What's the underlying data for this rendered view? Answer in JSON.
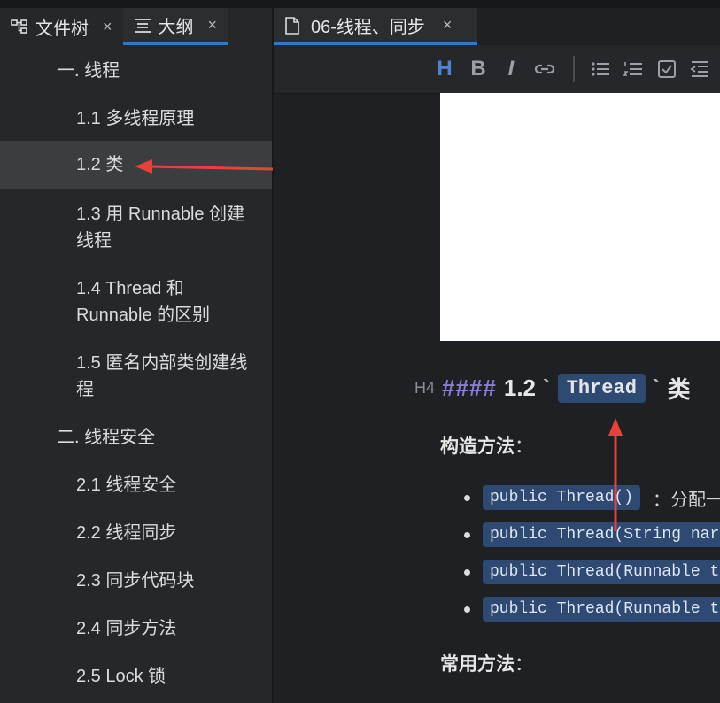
{
  "left_tabs": [
    {
      "label": "文件树",
      "close": "×",
      "icon": "file-tree-icon"
    },
    {
      "label": "大纲",
      "close": "×",
      "icon": "outline-icon"
    }
  ],
  "outline": [
    {
      "label": "一. 线程"
    },
    {
      "label": "1.1 多线程原理"
    },
    {
      "label": "1.2 类"
    },
    {
      "label": "1.3 用 Runnable 创建线程"
    },
    {
      "label": "1.4 Thread 和 Runnable 的区别"
    },
    {
      "label": "1.5 匿名内部类创建线程"
    },
    {
      "label": "二. 线程安全"
    },
    {
      "label": "2.1 线程安全"
    },
    {
      "label": "2.2 线程同步"
    },
    {
      "label": "2.3 同步代码块"
    },
    {
      "label": "2.4 同步方法"
    },
    {
      "label": "2.5 Lock 锁"
    }
  ],
  "doc_tab": {
    "label": "06-线程、同步",
    "close": "×",
    "icon": "document-icon"
  },
  "toolbar": {
    "heading": "H",
    "bold": "B",
    "italic": "I"
  },
  "editor": {
    "heading_level": "H4",
    "heading_hashes": "####",
    "heading_number": "1.2",
    "heading_tick_open": "`",
    "heading_code": "Thread",
    "heading_tick_close": "`",
    "heading_suffix": "类",
    "constructors_label": "构造方法",
    "colon": "：",
    "constructors": [
      {
        "code": "public Thread()",
        "after": "：分配一"
      },
      {
        "code": "public Thread(String nar",
        "after": ""
      },
      {
        "code": "public Thread(Runnable t",
        "after": ""
      },
      {
        "code": "public Thread(Runnable t",
        "after": ""
      }
    ],
    "methods_label": "常用方法"
  },
  "colors": {
    "accent": "#2f77c9",
    "code_bg": "#2e4a73",
    "annotation_arrow": "#e8403a"
  }
}
